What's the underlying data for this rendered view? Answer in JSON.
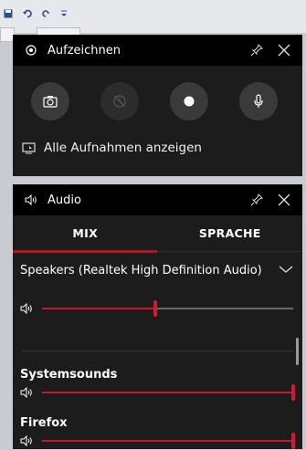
{
  "recording": {
    "title": "Aufzeichnen",
    "show_all_label": "Alle Aufnahmen anzeigen",
    "buttons": [
      "screenshot-icon",
      "record-last-disabled-icon",
      "record-icon",
      "microphone-icon"
    ]
  },
  "audio": {
    "title": "Audio",
    "tabs": [
      "MIX",
      "SPRACHE"
    ],
    "active_tab": "MIX",
    "device": {
      "name": "Speakers (Realtek High Definition Audio)",
      "volume": 0.45
    },
    "apps": [
      {
        "name": "Systemsounds",
        "volume": 1.0
      },
      {
        "name": "Firefox",
        "volume": 1.0
      }
    ]
  },
  "colors": {
    "accent": "#c7172a",
    "panel_bg": "#1c1c1c",
    "header_bg": "#000000"
  }
}
